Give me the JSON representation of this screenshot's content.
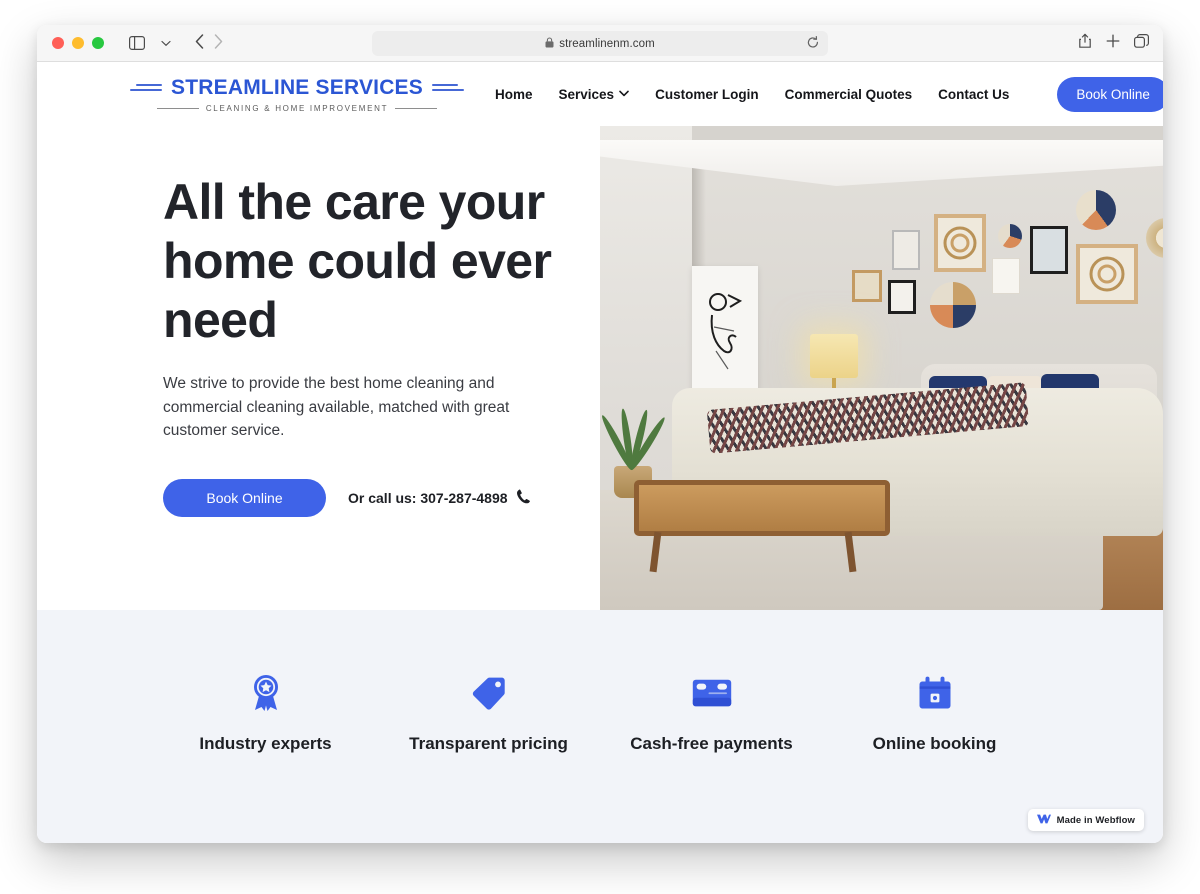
{
  "browser": {
    "url": "streamlinenm.com",
    "lock_icon": "lock-icon",
    "reload_icon": "reload-icon",
    "sidebar_icon": "sidebar-toggle-icon",
    "tab_overview_icon": "tab-overview-icon",
    "back_icon": "back-arrow-icon",
    "forward_icon": "forward-arrow-icon",
    "share_icon": "share-icon",
    "new_tab_icon": "plus-icon",
    "tabs_icon": "tabs-icon"
  },
  "site": {
    "logo": {
      "title": "STREAMLINE SERVICES",
      "subtitle": "CLEANING & HOME IMPROVEMENT",
      "brand_color": "#2b56d4"
    },
    "nav": {
      "items": [
        {
          "label": "Home",
          "has_dropdown": false
        },
        {
          "label": "Services",
          "has_dropdown": true
        },
        {
          "label": "Customer Login",
          "has_dropdown": false
        },
        {
          "label": "Commercial Quotes",
          "has_dropdown": false
        },
        {
          "label": "Contact Us",
          "has_dropdown": false
        }
      ],
      "cta_label": "Book Online",
      "cta_color": "#3f63e8"
    },
    "hero": {
      "heading": "All the care your home could ever need",
      "paragraph": "We strive to provide the best home cleaning and commercial cleaning available, matched with great customer service.",
      "cta_label": "Book Online",
      "call_text": "Or call us: 307-287-4898",
      "phone_icon": "phone-icon",
      "image_alt": "bedroom-interior-photo"
    },
    "features": {
      "background_color": "#f2f4f9",
      "icon_color": "#3f63e8",
      "items": [
        {
          "label": "Industry experts",
          "icon": "award-ribbon-icon"
        },
        {
          "label": "Transparent pricing",
          "icon": "price-tag-icon"
        },
        {
          "label": "Cash-free payments",
          "icon": "credit-card-icon"
        },
        {
          "label": "Online booking",
          "icon": "calendar-icon"
        }
      ]
    },
    "badge": {
      "label": "Made in Webflow",
      "icon": "webflow-logo-icon"
    }
  }
}
